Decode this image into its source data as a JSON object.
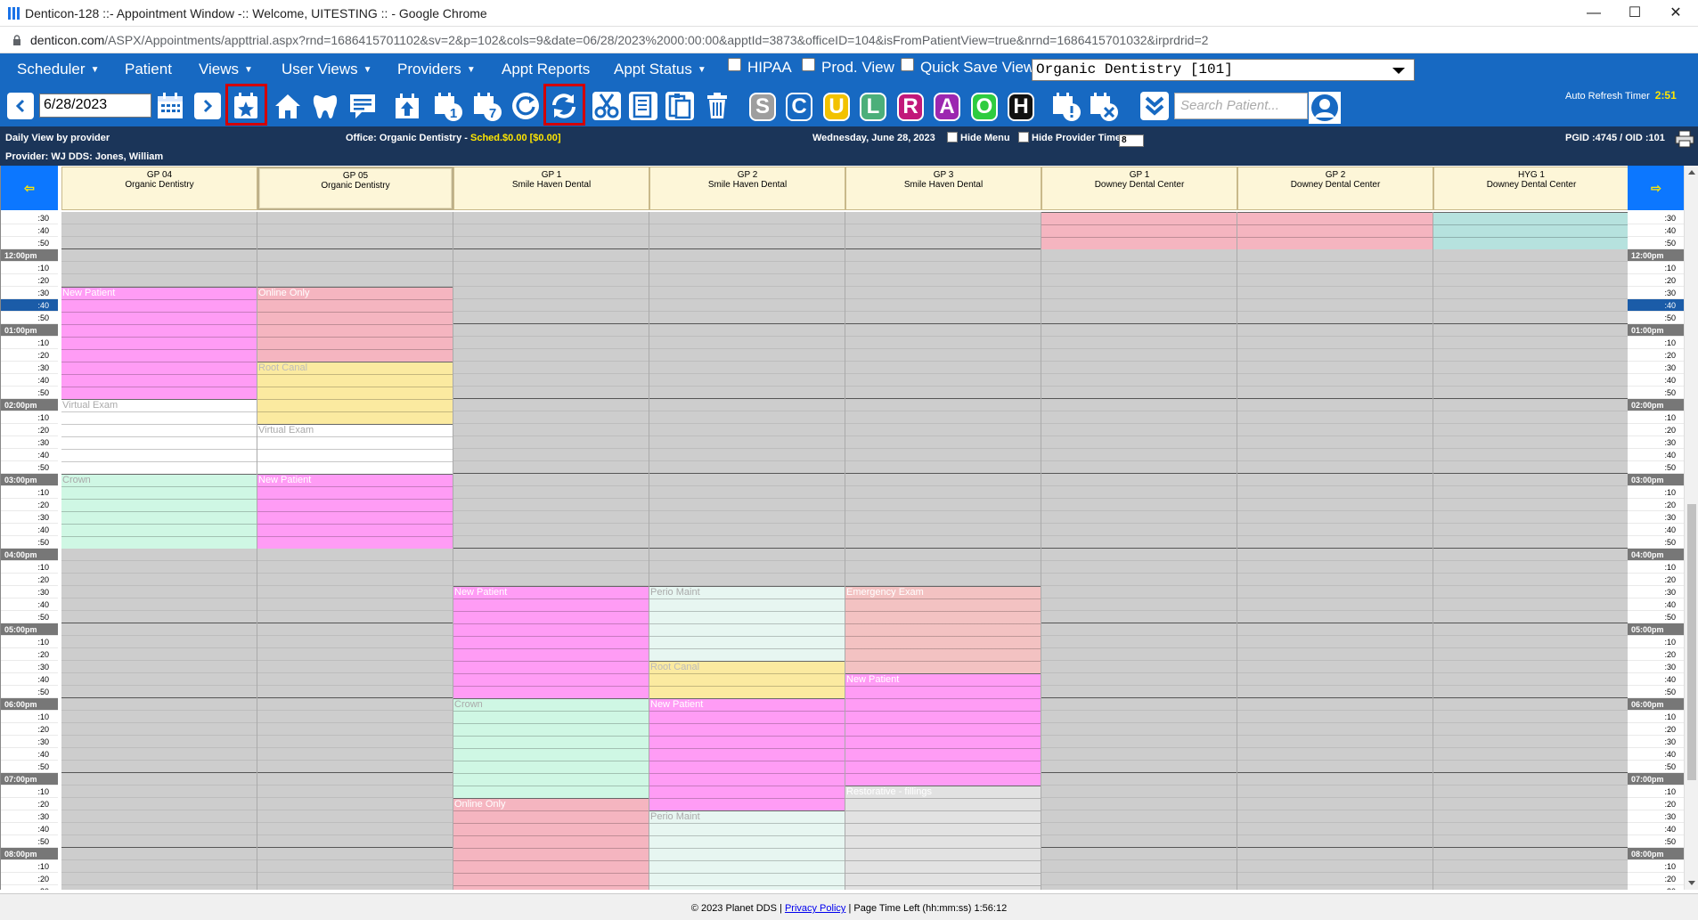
{
  "window": {
    "title": "Denticon-128 ::- Appointment Window -:: Welcome, UITESTING :: - Google Chrome",
    "minimize": "—",
    "maximize": "☐",
    "close": "✕"
  },
  "url": {
    "host": "denticon.com",
    "path": "/ASPX/Appointments/appttrial.aspx?rnd=1686415701102&sv=2&p=102&cols=9&date=06/28/2023%2000:00:00&apptId=3873&officeID=104&isFromPatientView=true&nrnd=1686415701032&irprdrid=2"
  },
  "menu": {
    "items": [
      "Scheduler",
      "Patient",
      "Views",
      "User Views",
      "Providers",
      "Appt Reports",
      "Appt Status"
    ],
    "checkboxes": [
      "HIPAA",
      "Prod. View",
      "Quick Save View"
    ],
    "office": "Organic Dentistry [101]"
  },
  "toolbar": {
    "date": "6/28/2023",
    "letters": [
      "S",
      "C",
      "U",
      "L",
      "R",
      "A",
      "O",
      "H"
    ],
    "letter_colors": [
      "#9e9e9e",
      "#1769c2",
      "#f2c200",
      "#4caf7a",
      "#c2187a",
      "#9c27b0",
      "#2ecc40",
      "#111111"
    ],
    "search_placeholder": "Search Patient...",
    "refresh_label": "Auto Refresh Timer",
    "refresh_value": "2:51"
  },
  "info": {
    "view": "Daily View by provider",
    "office_label": "Office: Organic Dentistry - ",
    "sched": "Sched.$0.00 [$0.00]",
    "date": "Wednesday, June 28, 2023",
    "hide_menu": "Hide Menu",
    "hide_provider_time": "Hide Provider Time",
    "zoom": "8",
    "ids": "PGID :4745  /  OID :101",
    "provider": "Provider: WJ DDS: Jones, William"
  },
  "columns": [
    {
      "op": "GP 04",
      "office": "Organic Dentistry"
    },
    {
      "op": "GP 05",
      "office": "Organic Dentistry"
    },
    {
      "op": "GP 1",
      "office": "Smile Haven Dental"
    },
    {
      "op": "GP 2",
      "office": "Smile Haven Dental"
    },
    {
      "op": "GP 3",
      "office": "Smile Haven Dental"
    },
    {
      "op": "GP 1",
      "office": "Downey Dental Center"
    },
    {
      "op": "GP 2",
      "office": "Downey Dental Center"
    },
    {
      "op": "HYG 1",
      "office": "Downey Dental Center"
    }
  ],
  "time_labels": [
    ":30",
    ":40",
    ":50",
    "12:00pm",
    ":10",
    ":20",
    ":30",
    ":40",
    ":50",
    "01:00pm",
    ":10",
    ":20",
    ":30",
    ":40",
    ":50",
    "02:00pm",
    ":10",
    ":20",
    ":30",
    ":40",
    ":50",
    "03:00pm",
    ":10",
    ":20",
    ":30",
    ":40",
    ":50",
    "04:00pm",
    ":10",
    ":20",
    ":30",
    ":40",
    ":50",
    "05:00pm",
    ":10",
    ":20",
    ":30",
    ":40",
    ":50",
    "06:00pm",
    ":10",
    ":20",
    ":30",
    ":40",
    ":50",
    "07:00pm",
    ":10",
    ":20",
    ":30",
    ":40",
    ":50",
    "08:00pm",
    ":10",
    ":20",
    ":30"
  ],
  "current_slot": 7,
  "appointments": [
    {
      "col": 0,
      "start": 6,
      "len": 9,
      "label": "New Patient",
      "cls": "c-magenta"
    },
    {
      "col": 0,
      "start": 15,
      "len": 6,
      "label": "Virtual Exam",
      "cls": "c-white"
    },
    {
      "col": 0,
      "start": 21,
      "len": 6,
      "label": "Crown",
      "cls": "c-mint"
    },
    {
      "col": 1,
      "start": 6,
      "len": 6,
      "label": "Online Only",
      "cls": "c-pink"
    },
    {
      "col": 1,
      "start": 12,
      "len": 5,
      "label": "Root Canal",
      "cls": "c-yellow"
    },
    {
      "col": 1,
      "start": 17,
      "len": 4,
      "label": "Virtual Exam",
      "cls": "c-white"
    },
    {
      "col": 1,
      "start": 21,
      "len": 6,
      "label": "New Patient",
      "cls": "c-magenta"
    },
    {
      "col": 2,
      "start": 30,
      "len": 9,
      "label": "New Patient",
      "cls": "c-magenta"
    },
    {
      "col": 2,
      "start": 39,
      "len": 8,
      "label": "Crown",
      "cls": "c-mint"
    },
    {
      "col": 2,
      "start": 47,
      "len": 8,
      "label": "Online Only",
      "cls": "c-pink"
    },
    {
      "col": 3,
      "start": 30,
      "len": 6,
      "label": "Perio Maint",
      "cls": "c-lmint"
    },
    {
      "col": 3,
      "start": 36,
      "len": 3,
      "label": "Root Canal",
      "cls": "c-yellow"
    },
    {
      "col": 3,
      "start": 39,
      "len": 9,
      "label": "New Patient",
      "cls": "c-magenta"
    },
    {
      "col": 3,
      "start": 48,
      "len": 7,
      "label": "Perio Maint",
      "cls": "c-lmint"
    },
    {
      "col": 4,
      "start": 30,
      "len": 7,
      "label": "Emergency Exam",
      "cls": "c-salmon"
    },
    {
      "col": 4,
      "start": 37,
      "len": 9,
      "label": "New Patient",
      "cls": "c-magenta"
    },
    {
      "col": 4,
      "start": 46,
      "len": 9,
      "label": "Restorative - fillings",
      "cls": "c-lgray"
    },
    {
      "col": 5,
      "start": 0,
      "len": 3,
      "label": "",
      "cls": "c-pink"
    },
    {
      "col": 6,
      "start": 0,
      "len": 3,
      "label": "",
      "cls": "c-pink"
    },
    {
      "col": 7,
      "start": 0,
      "len": 3,
      "label": "",
      "cls": "c-teal"
    }
  ],
  "footer": {
    "copyright": "© 2023 Planet DDS |",
    "privacy": "Privacy Policy",
    "time_left": "| Page Time Left (hh:mm:ss) 1:56:12"
  }
}
